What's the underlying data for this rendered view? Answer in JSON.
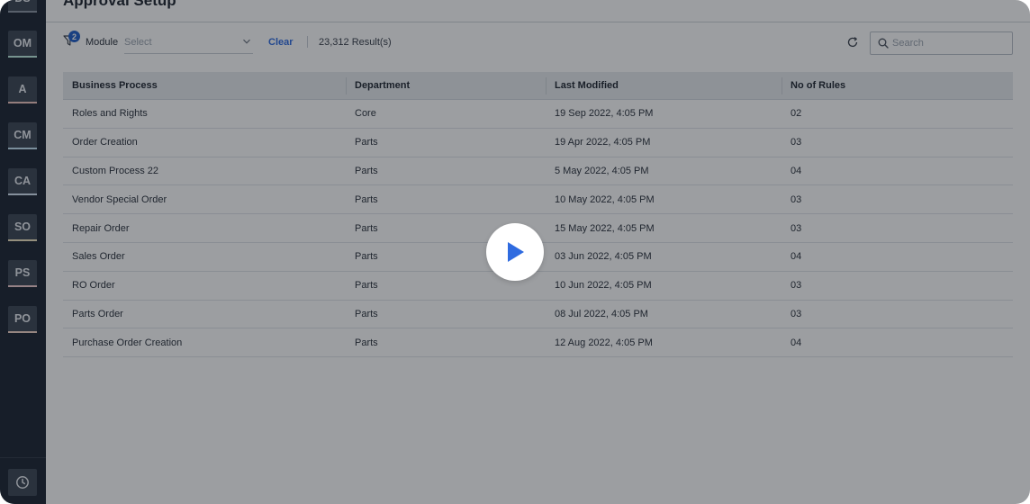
{
  "page": {
    "title": "Approval Setup"
  },
  "sidebar": {
    "items": [
      {
        "label": "DS",
        "accent": "#8b95a3"
      },
      {
        "label": "OM",
        "accent": "#bfeee0"
      },
      {
        "label": "A",
        "accent": "#f2c6c0"
      },
      {
        "label": "CM",
        "accent": "#c7e6f6"
      },
      {
        "label": "CA",
        "accent": "#d8e7f7"
      },
      {
        "label": "SO",
        "accent": "#f1e6c2"
      },
      {
        "label": "PS",
        "accent": "#f5cfd0"
      },
      {
        "label": "PO",
        "accent": "#f5d6c8"
      }
    ],
    "bottom_icon": "history-clock-icon"
  },
  "toolbar": {
    "filter_icon": "filter-icon",
    "filter_count": "2",
    "module_label": "Module",
    "module_placeholder": "Select",
    "clear_label": "Clear",
    "result_count": "23,312 Result(s)",
    "refresh_icon": "refresh-icon",
    "search_placeholder": "Search"
  },
  "table": {
    "columns": [
      "Business Process",
      "Department",
      "Last Modified",
      "No of Rules"
    ],
    "rows": [
      [
        "Roles and Rights",
        "Core",
        "19 Sep 2022, 4:05 PM",
        "02"
      ],
      [
        "Order Creation",
        "Parts",
        "19 Apr 2022, 4:05 PM",
        "03"
      ],
      [
        "Custom Process 22",
        "Parts",
        "5 May 2022, 4:05 PM",
        "04"
      ],
      [
        "Vendor Special Order",
        "Parts",
        "10 May 2022, 4:05 PM",
        "03"
      ],
      [
        "Repair Order",
        "Parts",
        "15 May 2022, 4:05 PM",
        "03"
      ],
      [
        "Sales Order",
        "Parts",
        "03 Jun 2022, 4:05 PM",
        "04"
      ],
      [
        "RO Order",
        "Parts",
        "10 Jun 2022, 4:05 PM",
        "03"
      ],
      [
        "Parts Order",
        "Parts",
        "08 Jul 2022, 4:05 PM",
        "03"
      ],
      [
        "Purchase Order Creation",
        "Parts",
        "12 Aug 2022, 4:05 PM",
        "04"
      ]
    ]
  },
  "video": {
    "play_icon": "play-icon",
    "accent": "#2f6be0"
  }
}
